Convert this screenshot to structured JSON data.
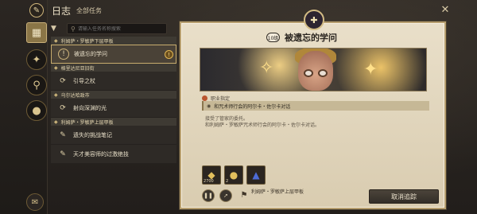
{
  "header": {
    "title": "日志",
    "subtitle": "全部任务",
    "app_icon": "quill-icon"
  },
  "search": {
    "placeholder": "请输入任务名称搜索"
  },
  "rail": {
    "items": [
      {
        "name": "journal-grid-icon",
        "glyph": "▦",
        "active": true
      },
      {
        "name": "quest-scroll-icon",
        "glyph": "✦",
        "active": false
      },
      {
        "name": "search-quest-icon",
        "glyph": "⚲",
        "active": false
      },
      {
        "name": "hint-lightbulb-icon",
        "glyph": "●",
        "active": false
      }
    ],
    "bottom": {
      "name": "mail-icon",
      "glyph": "✉"
    }
  },
  "quest_list": [
    {
      "type": "group",
      "label": "利姆萨・罗敏萨下层甲板"
    },
    {
      "type": "item",
      "label": "被遗忘的学问",
      "selected": true,
      "warning": true,
      "icon": "!"
    },
    {
      "type": "group",
      "label": "格里达尼亚旧街"
    },
    {
      "type": "item",
      "label": "引导之杖",
      "selected": false,
      "warning": false,
      "icon": "⟳"
    },
    {
      "type": "group",
      "label": "乌尔达哈政市"
    },
    {
      "type": "item",
      "label": "射向深渊的光",
      "selected": false,
      "warning": false,
      "icon": "⟳"
    },
    {
      "type": "group",
      "label": "利姆萨・罗敏萨上层甲板"
    },
    {
      "type": "item",
      "label": "遗失的挑战笔记",
      "selected": false,
      "warning": false,
      "icon": "✎"
    },
    {
      "type": "item",
      "label": "天才美容师的过激绝技",
      "selected": false,
      "warning": false,
      "icon": "✎"
    }
  ],
  "detail": {
    "level": "10级",
    "title": "被遗忘的学问",
    "section_label": "职业指定",
    "objective": "和咒术师行会的阿尔卡・佐尔卡对话",
    "description_line1": "接受了管家的委托。",
    "description_line2": "和利姆萨・罗敏萨咒术师行会的阿尔卡・佐尔卡对话。",
    "rewards": [
      {
        "icon": "gil-coins-icon",
        "glyph": "◆",
        "count": "2700"
      },
      {
        "icon": "medal-icon",
        "glyph": "●",
        "count": "2"
      },
      {
        "icon": "ship-icon",
        "glyph": "▲",
        "count": ""
      }
    ],
    "location": "利姆萨・罗敏萨上层甲板",
    "track_button": "取消追踪"
  },
  "colors": {
    "accent_gold": "#c8ad6e",
    "panel_bg": "#e9dfc9",
    "list_bg": "#2e2a26"
  }
}
